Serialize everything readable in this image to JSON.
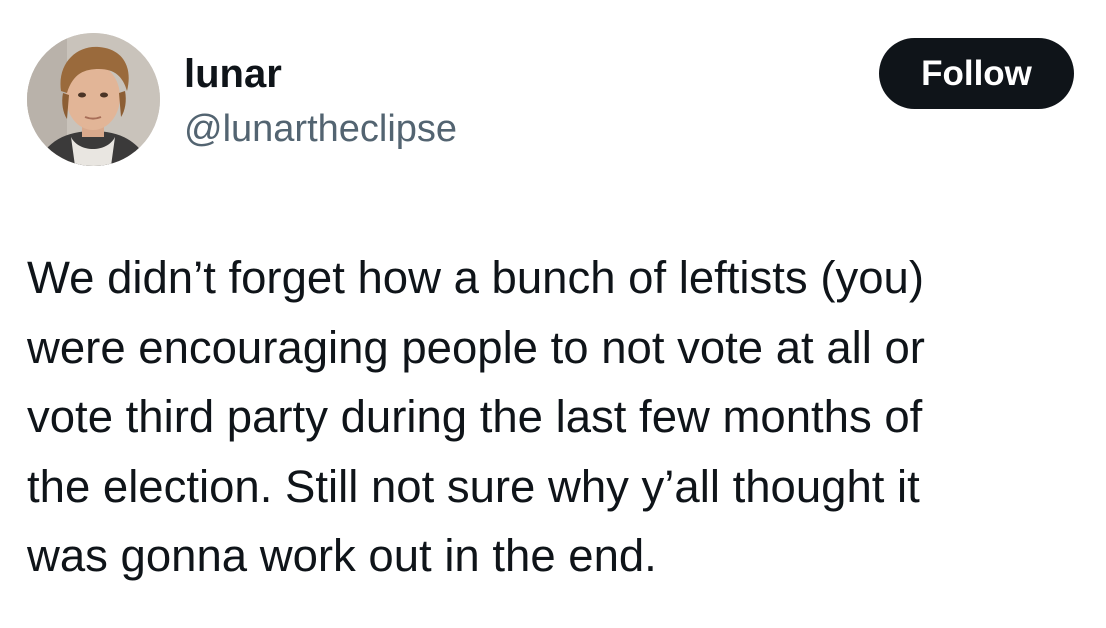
{
  "author": {
    "display_name": "lunar",
    "handle": "@lunartheclipse"
  },
  "actions": {
    "follow_label": "Follow"
  },
  "tweet": {
    "lines": [
      "We didn’t forget how a bunch of leftists (you)",
      "were encouraging people to not vote at all or",
      "vote third party during the last few months of",
      "the election. Still not sure why y’all thought it",
      "was gonna work out in the end."
    ]
  },
  "colors": {
    "text_primary": "#0f1419",
    "text_secondary": "#536471",
    "button_background": "#0f1419",
    "button_text": "#ffffff",
    "background": "#ffffff"
  }
}
